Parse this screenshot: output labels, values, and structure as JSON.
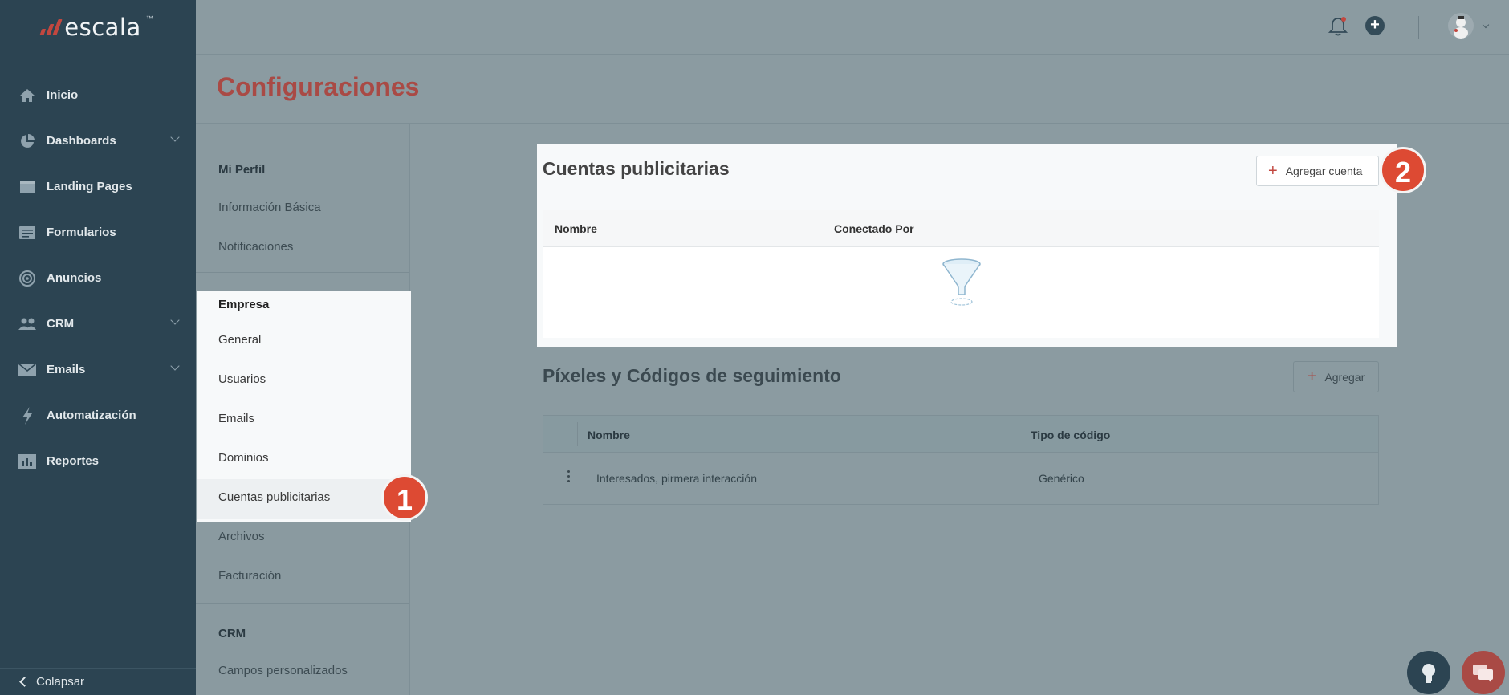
{
  "app": {
    "brand": "escala"
  },
  "sidebar": {
    "items": [
      {
        "label": "Inicio",
        "icon": "home-icon",
        "has_chevron": false
      },
      {
        "label": "Dashboards",
        "icon": "pie-chart-icon",
        "has_chevron": true
      },
      {
        "label": "Landing Pages",
        "icon": "browser-window-icon",
        "has_chevron": false
      },
      {
        "label": "Formularios",
        "icon": "form-icon",
        "has_chevron": false
      },
      {
        "label": "Anuncios",
        "icon": "target-icon",
        "has_chevron": false
      },
      {
        "label": "CRM",
        "icon": "people-icon",
        "has_chevron": true
      },
      {
        "label": "Emails",
        "icon": "envelope-icon",
        "has_chevron": true
      },
      {
        "label": "Automatización",
        "icon": "lightning-icon",
        "has_chevron": false
      },
      {
        "label": "Reportes",
        "icon": "report-icon",
        "has_chevron": false
      }
    ],
    "collapse_label": "Colapsar"
  },
  "header": {
    "icons": [
      "bell-icon",
      "plus-circle-icon",
      "avatar"
    ],
    "accent_color": "#c2473f"
  },
  "page": {
    "title": "Configuraciones"
  },
  "settings_menu": {
    "perfil": {
      "heading": "Mi Perfil",
      "items": [
        "Información Básica",
        "Notificaciones"
      ]
    },
    "empresa": {
      "heading": "Empresa",
      "items": [
        "General",
        "Usuarios",
        "Emails",
        "Dominios",
        "Cuentas publicitarias",
        "Archivos",
        "Facturación"
      ]
    },
    "crm": {
      "heading": "CRM",
      "items": [
        "Campos personalizados"
      ]
    },
    "active_item": "Cuentas publicitarias"
  },
  "ad_accounts": {
    "title": "Cuentas publicitarias",
    "add_button": "Agregar cuenta",
    "columns": [
      "Nombre",
      "Conectado Por"
    ],
    "empty_icon": "empty-funnel-icon"
  },
  "pixels": {
    "title": "Píxeles y Códigos de seguimiento",
    "add_button": "Agregar",
    "columns": [
      "Nombre",
      "Tipo de código"
    ],
    "rows": [
      {
        "name": "Interesados, pirmera interacción",
        "type": "Genérico"
      }
    ]
  },
  "annotations": {
    "step1": "1",
    "step2": "2",
    "color": "#dd4a33"
  },
  "floating": [
    "lightbulb-icon",
    "chat-icon"
  ]
}
